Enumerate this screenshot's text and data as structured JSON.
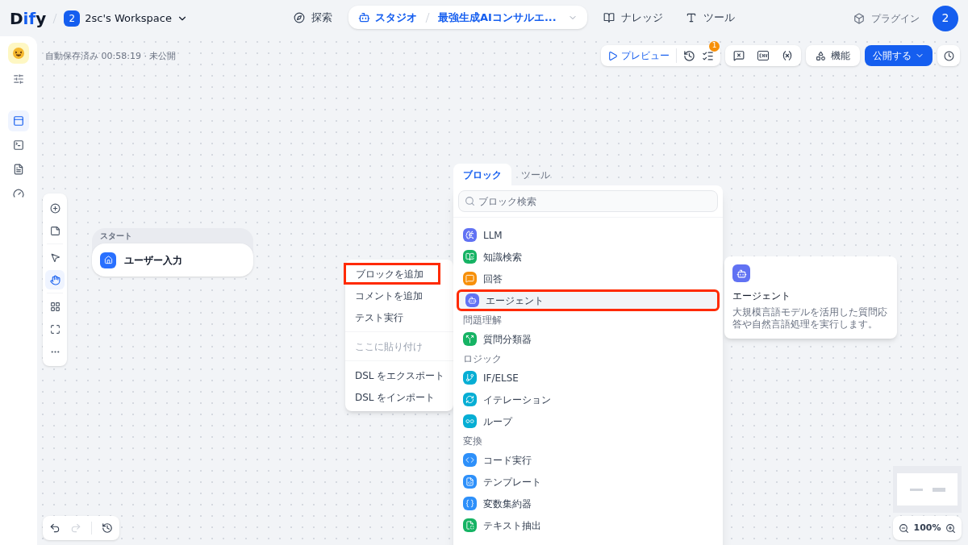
{
  "header": {
    "logo": "Dify",
    "workspace": {
      "badge": "2",
      "name": "2sc's Workspace"
    },
    "nav": [
      {
        "label": "探索",
        "selected": false
      },
      {
        "label": "スタジオ",
        "selected": true,
        "app": "最強生成AIコンサルエ..."
      },
      {
        "label": "ナレッジ",
        "selected": false
      },
      {
        "label": "ツール",
        "selected": false
      }
    ],
    "plugins": "プラグイン",
    "avatar": "2"
  },
  "status": "自動保存済み 00:58:19 · 未公開",
  "toolbar": {
    "preview": "プレビュー",
    "checklist_badge": "1",
    "features": "機能",
    "publish": "公開する"
  },
  "rail": [
    {
      "selected": true
    },
    {
      "selected": false
    },
    {
      "selected": false
    },
    {
      "selected": false
    }
  ],
  "tools": [
    {
      "selected": false
    },
    {
      "selected": false
    },
    {
      "selected": false
    },
    {
      "selected": true
    },
    {
      "selected": false
    },
    {
      "selected": false
    },
    {
      "selected": false
    }
  ],
  "start_node": {
    "label": "スタート",
    "title": "ユーザー入力"
  },
  "context_menu": [
    {
      "label": "ブロックを追加",
      "disabled": false,
      "highlighted": true
    },
    {
      "label": "コメントを追加",
      "disabled": false,
      "highlighted": false
    },
    {
      "label": "テスト実行",
      "disabled": false,
      "highlighted": false
    },
    {
      "label": "ここに貼り付け",
      "disabled": true,
      "highlighted": false
    },
    {
      "label": "DSL をエクスポート",
      "disabled": false,
      "highlighted": false
    },
    {
      "label": "DSL をインポート",
      "disabled": false,
      "highlighted": false
    }
  ],
  "block_panel": {
    "tabs": [
      {
        "label": "ブロック",
        "selected": true
      },
      {
        "label": "ツール",
        "selected": false
      }
    ],
    "search": {
      "placeholder": "ブロック検索"
    },
    "groups": [
      {
        "items": [
          {
            "label": "LLM",
            "color": "#6172f3",
            "selected": false,
            "highlighted": false
          },
          {
            "label": "知識検索",
            "color": "#16b364",
            "selected": false,
            "highlighted": false
          },
          {
            "label": "回答",
            "color": "#f79009",
            "selected": false,
            "highlighted": false
          },
          {
            "label": "エージェント",
            "color": "#6172f3",
            "selected": true,
            "highlighted": true
          }
        ]
      },
      {
        "heading": "問題理解",
        "items": [
          {
            "label": "質問分類器",
            "color": "#16b364",
            "selected": false,
            "highlighted": false
          }
        ]
      },
      {
        "heading": "ロジック",
        "items": [
          {
            "label": "IF/ELSE",
            "color": "#06aed4",
            "selected": false,
            "highlighted": false
          },
          {
            "label": "イテレーション",
            "color": "#06aed4",
            "selected": false,
            "highlighted": false
          },
          {
            "label": "ループ",
            "color": "#06aed4",
            "selected": false,
            "highlighted": false
          }
        ]
      },
      {
        "heading": "変換",
        "items": [
          {
            "label": "コード実行",
            "color": "#2e90fa",
            "selected": false,
            "highlighted": false
          },
          {
            "label": "テンプレート",
            "color": "#2e90fa",
            "selected": false,
            "highlighted": false
          },
          {
            "label": "変数集約器",
            "color": "#2e90fa",
            "selected": false,
            "highlighted": false
          },
          {
            "label": "テキスト抽出",
            "color": "#16b364",
            "selected": false,
            "highlighted": false
          }
        ]
      }
    ]
  },
  "tooltip": {
    "title": "エージェント",
    "description": "大規模言語モデルを活用した質問応答や自然言語処理を実行します。"
  },
  "zoom": "100%"
}
